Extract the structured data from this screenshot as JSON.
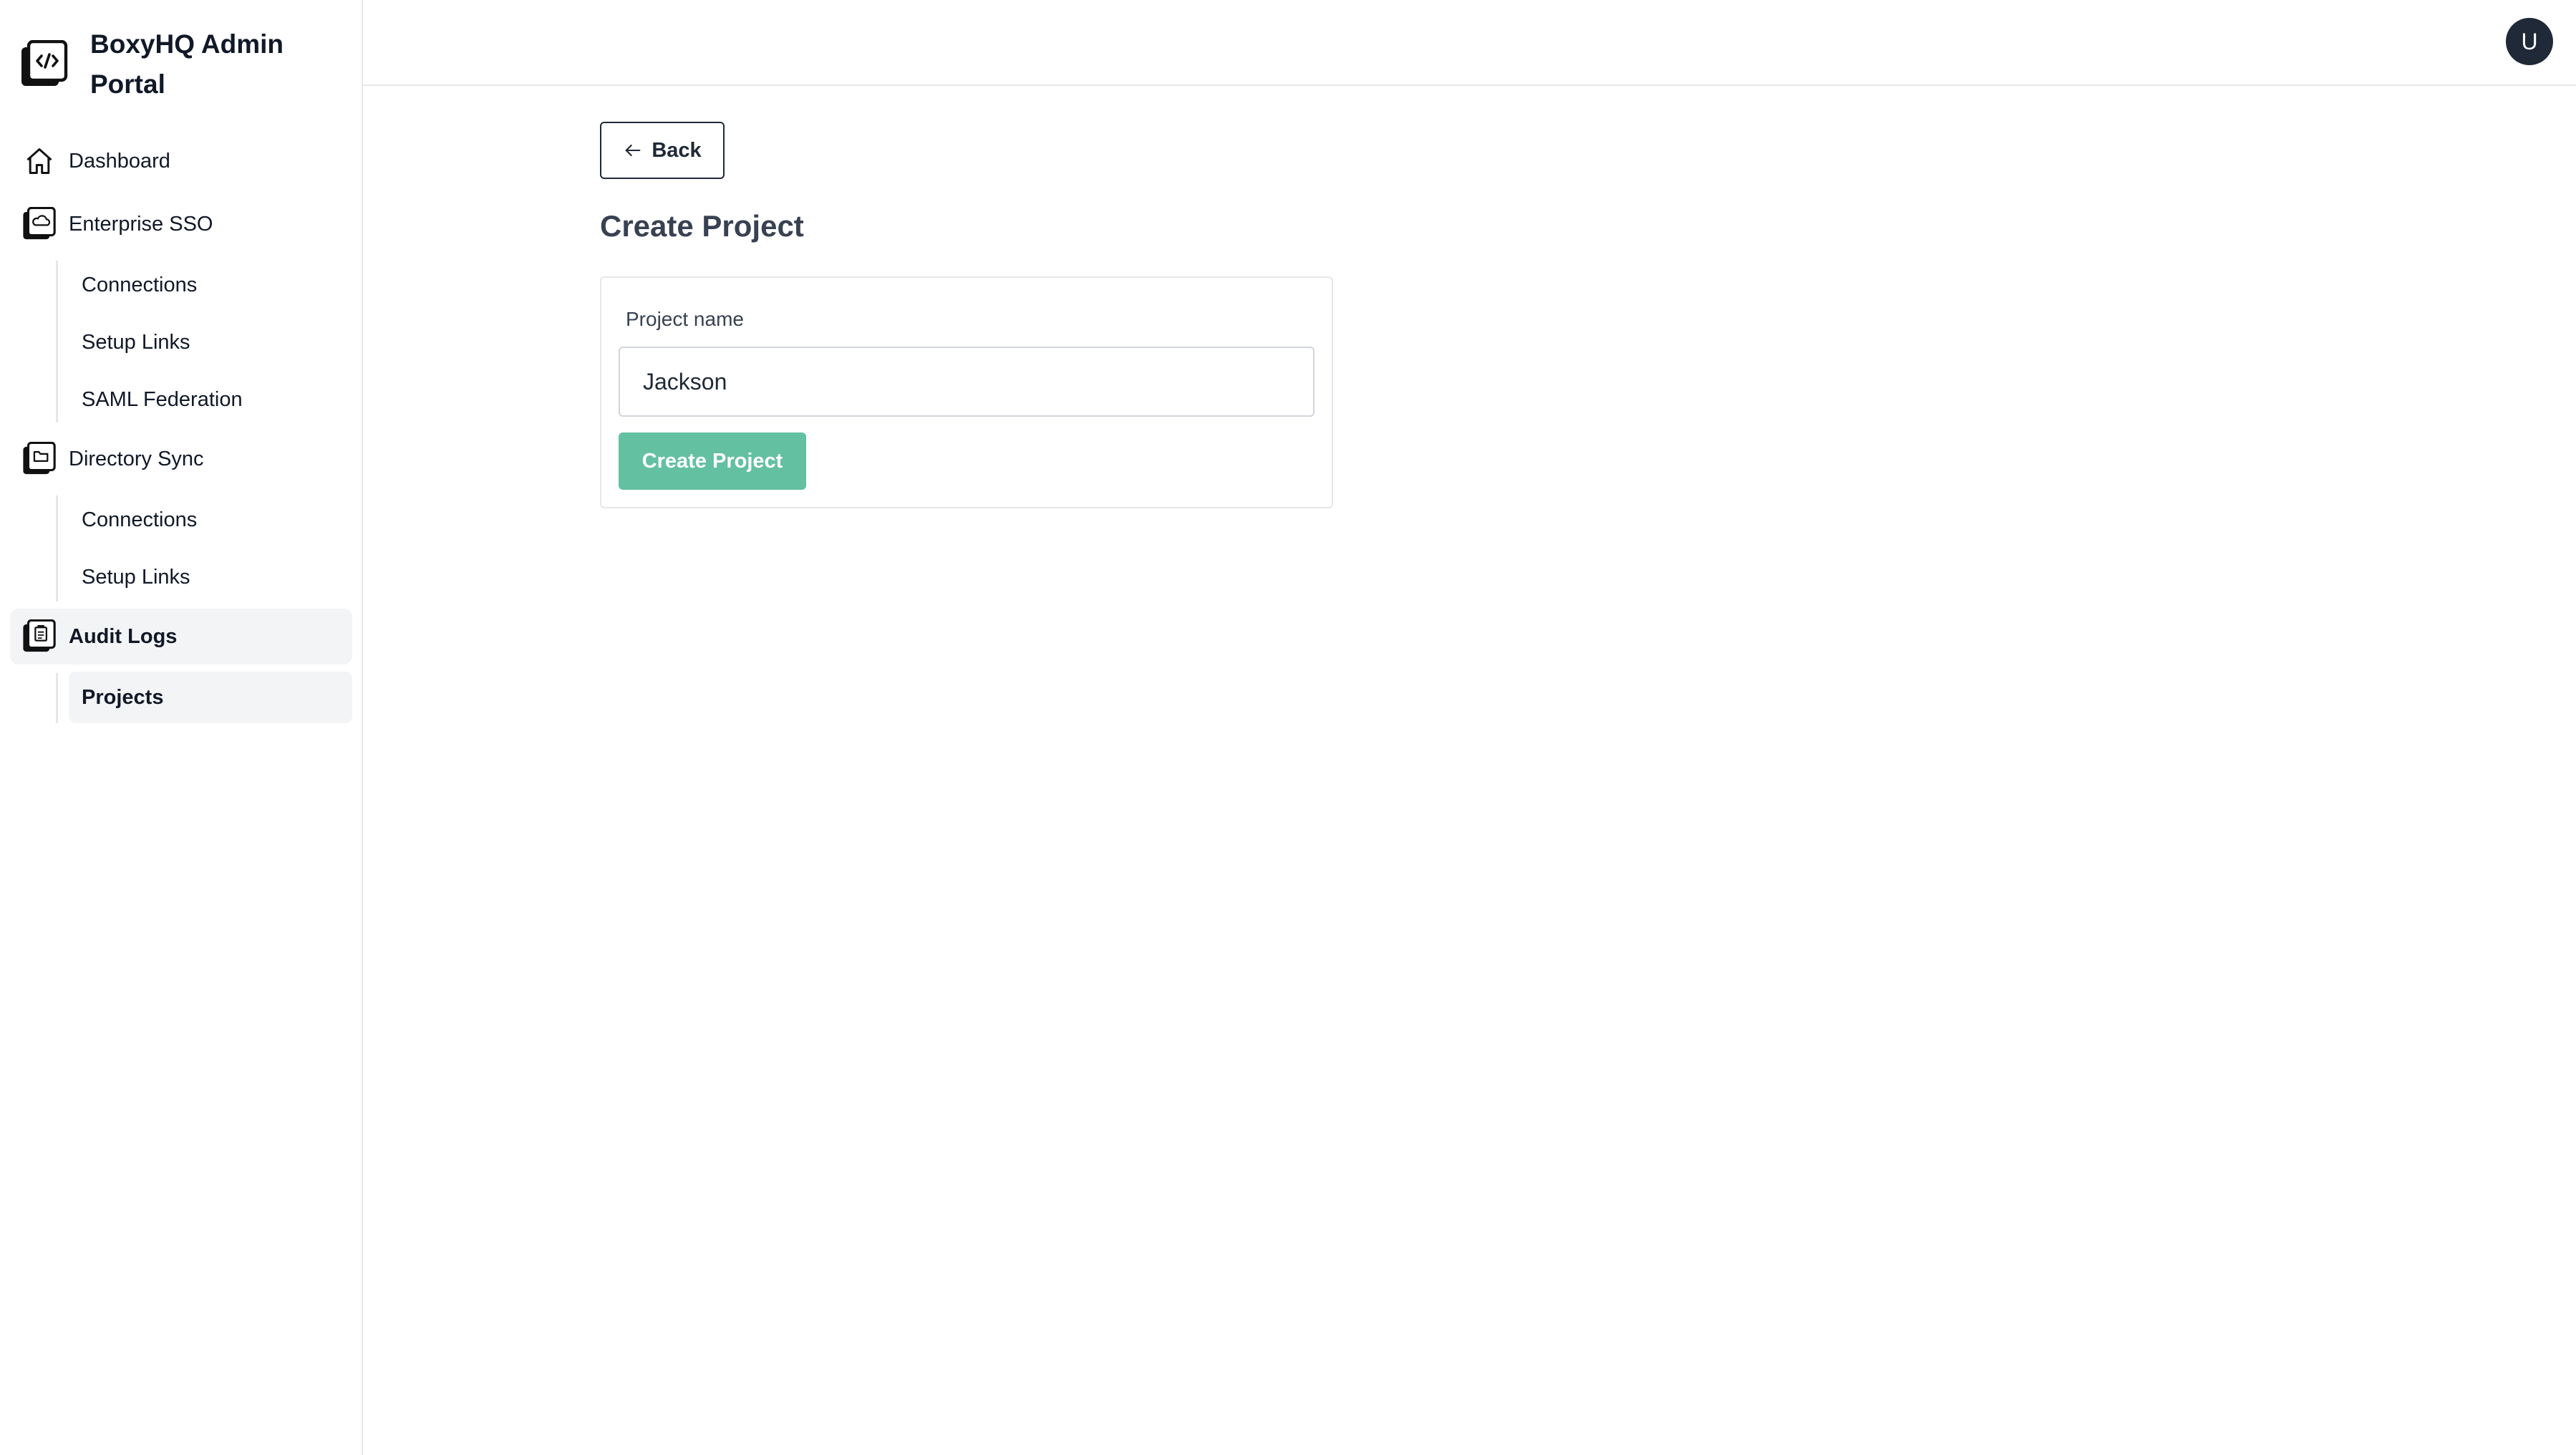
{
  "brand": {
    "title": "BoxyHQ Admin Portal"
  },
  "sidebar": {
    "dashboard": "Dashboard",
    "enterprise_sso": {
      "label": "Enterprise SSO",
      "items": [
        "Connections",
        "Setup Links",
        "SAML Federation"
      ]
    },
    "directory_sync": {
      "label": "Directory Sync",
      "items": [
        "Connections",
        "Setup Links"
      ]
    },
    "audit_logs": {
      "label": "Audit Logs",
      "items": [
        "Projects"
      ]
    }
  },
  "header": {
    "avatar_initial": "U"
  },
  "main": {
    "back_label": "Back",
    "title": "Create Project",
    "form": {
      "project_name_label": "Project name",
      "project_name_value": "Jackson",
      "submit_label": "Create Project"
    }
  },
  "colors": {
    "accent": "#63c0a1",
    "active_bg": "#f3f4f6",
    "avatar_bg": "#1f2937"
  },
  "icons": [
    "code-brackets-icon",
    "home-icon",
    "cloud-icon",
    "folder-icon",
    "clipboard-icon",
    "arrow-left-icon"
  ]
}
